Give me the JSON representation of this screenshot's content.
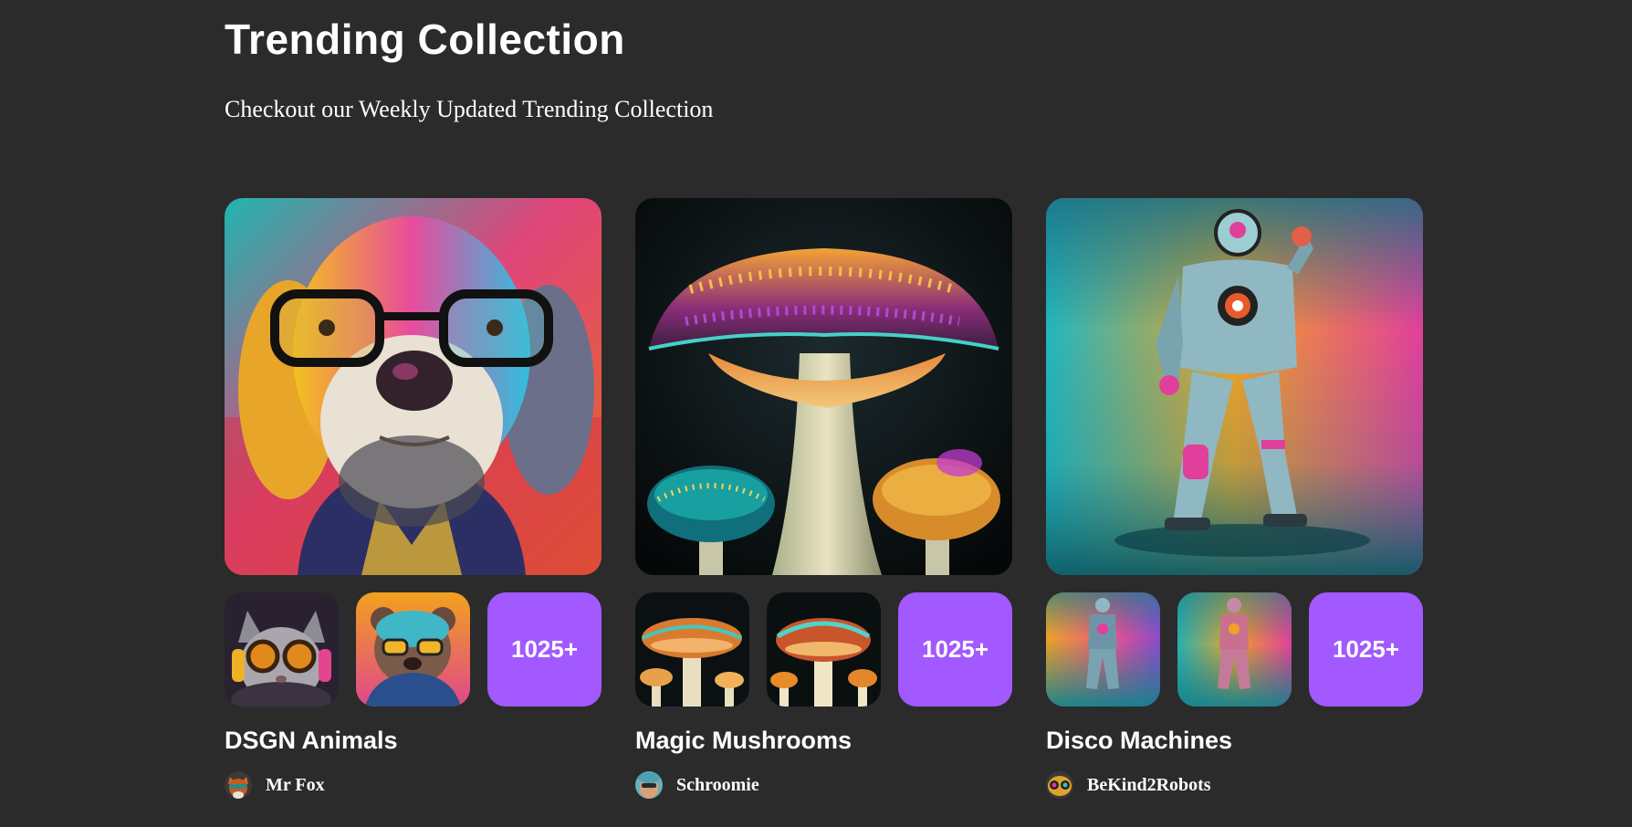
{
  "section": {
    "title": "Trending Collection",
    "subtitle": "Checkout our Weekly Updated Trending Collection"
  },
  "collections": [
    {
      "name": "DSGN Animals",
      "more_label": "1025+",
      "artist": "Mr Fox",
      "hero_image": "colorful-dog-with-glasses",
      "thumbs": [
        "cat-with-goggles",
        "bear-with-glasses"
      ]
    },
    {
      "name": "Magic Mushrooms",
      "more_label": "1025+",
      "artist": "Schroomie",
      "hero_image": "glowing-mushroom",
      "thumbs": [
        "mushroom-cluster",
        "mushroom-trio"
      ]
    },
    {
      "name": "Disco Machines",
      "more_label": "1025+",
      "artist": "BeKind2Robots",
      "hero_image": "neon-robot",
      "thumbs": [
        "robot-back-view",
        "robot-pink-suit"
      ]
    }
  ],
  "colors": {
    "background": "#2b2b2b",
    "accent": "#a259ff",
    "text": "#ffffff"
  }
}
